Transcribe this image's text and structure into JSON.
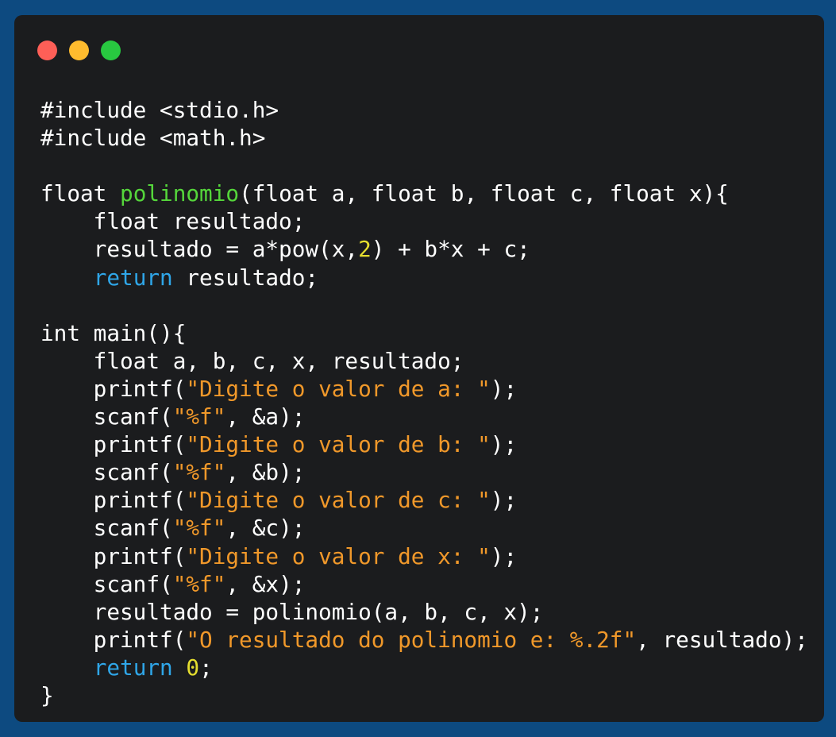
{
  "window": {
    "buttons": [
      "close",
      "minimize",
      "maximize"
    ],
    "colors": {
      "close": "#fe5f57",
      "minimize": "#febb2e",
      "maximize": "#28c840",
      "background": "#1b1c1e",
      "page_background": "#0d4a80"
    }
  },
  "code": {
    "lines": [
      [
        {
          "t": "plain",
          "v": "#include <stdio.h>"
        }
      ],
      [
        {
          "t": "plain",
          "v": "#include <math.h>"
        }
      ],
      [],
      [
        {
          "t": "plain",
          "v": "float "
        },
        {
          "t": "fn",
          "v": "polinomio"
        },
        {
          "t": "plain",
          "v": "(float a, float b, float c, float x){"
        }
      ],
      [
        {
          "t": "plain",
          "v": "    float resultado;"
        }
      ],
      [
        {
          "t": "plain",
          "v": "    resultado = a*pow(x,"
        },
        {
          "t": "num",
          "v": "2"
        },
        {
          "t": "plain",
          "v": ") + b*x + c;"
        }
      ],
      [
        {
          "t": "plain",
          "v": "    "
        },
        {
          "t": "kw",
          "v": "return"
        },
        {
          "t": "plain",
          "v": " resultado;"
        }
      ],
      [],
      [
        {
          "t": "plain",
          "v": "int main(){"
        }
      ],
      [
        {
          "t": "plain",
          "v": "    float a, b, c, x, resultado;"
        }
      ],
      [
        {
          "t": "plain",
          "v": "    printf("
        },
        {
          "t": "str",
          "v": "\"Digite o valor de a: \""
        },
        {
          "t": "plain",
          "v": ");"
        }
      ],
      [
        {
          "t": "plain",
          "v": "    scanf("
        },
        {
          "t": "str",
          "v": "\"%f\""
        },
        {
          "t": "plain",
          "v": ", &a);"
        }
      ],
      [
        {
          "t": "plain",
          "v": "    printf("
        },
        {
          "t": "str",
          "v": "\"Digite o valor de b: \""
        },
        {
          "t": "plain",
          "v": ");"
        }
      ],
      [
        {
          "t": "plain",
          "v": "    scanf("
        },
        {
          "t": "str",
          "v": "\"%f\""
        },
        {
          "t": "plain",
          "v": ", &b);"
        }
      ],
      [
        {
          "t": "plain",
          "v": "    printf("
        },
        {
          "t": "str",
          "v": "\"Digite o valor de c: \""
        },
        {
          "t": "plain",
          "v": ");"
        }
      ],
      [
        {
          "t": "plain",
          "v": "    scanf("
        },
        {
          "t": "str",
          "v": "\"%f\""
        },
        {
          "t": "plain",
          "v": ", &c);"
        }
      ],
      [
        {
          "t": "plain",
          "v": "    printf("
        },
        {
          "t": "str",
          "v": "\"Digite o valor de x: \""
        },
        {
          "t": "plain",
          "v": ");"
        }
      ],
      [
        {
          "t": "plain",
          "v": "    scanf("
        },
        {
          "t": "str",
          "v": "\"%f\""
        },
        {
          "t": "plain",
          "v": ", &x);"
        }
      ],
      [
        {
          "t": "plain",
          "v": "    resultado = polinomio(a, b, c, x);"
        }
      ],
      [
        {
          "t": "plain",
          "v": "    printf("
        },
        {
          "t": "str",
          "v": "\"O resultado do polinomio e: %.2f\""
        },
        {
          "t": "plain",
          "v": ", resultado);"
        }
      ],
      [
        {
          "t": "plain",
          "v": "    "
        },
        {
          "t": "kw",
          "v": "return"
        },
        {
          "t": "plain",
          "v": " "
        },
        {
          "t": "num",
          "v": "0"
        },
        {
          "t": "plain",
          "v": ";"
        }
      ],
      [
        {
          "t": "plain",
          "v": "}"
        }
      ]
    ]
  }
}
